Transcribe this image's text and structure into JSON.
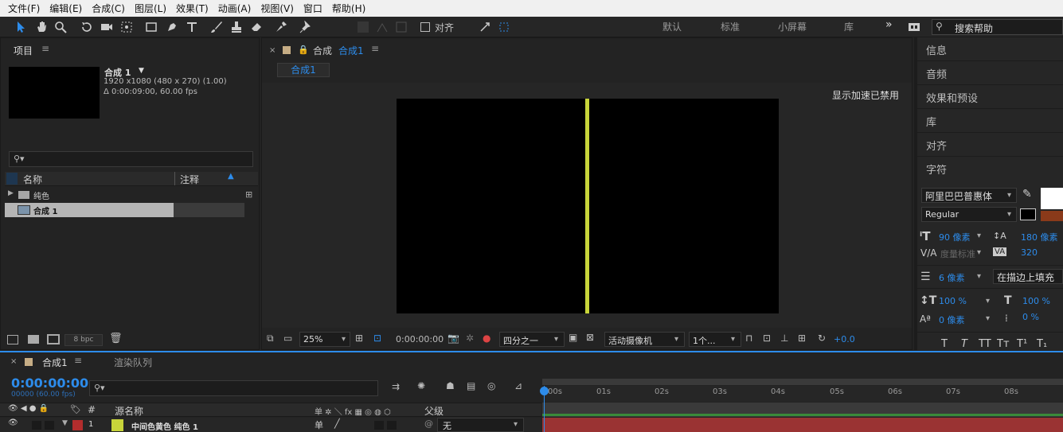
{
  "menu": [
    "文件(F)",
    "编辑(E)",
    "合成(C)",
    "图层(L)",
    "效果(T)",
    "动画(A)",
    "视图(V)",
    "窗口",
    "帮助(H)"
  ],
  "toolbar": {
    "align_label": "对齐",
    "workspaces": [
      "默认",
      "标准",
      "小屏幕",
      "库"
    ],
    "more": "»",
    "search_placeholder": "搜索帮助"
  },
  "project": {
    "title": "项目",
    "comp_name": "合成 1",
    "comp_arrow": "▼",
    "comp_info1": "1920 x1080  (480 x 270)  (1.00)",
    "comp_info2": "Δ 0:00:09:00, 60.00 fps",
    "search_icon": "⚲▾",
    "col_name": "名称",
    "col_comment": "注释",
    "items": [
      {
        "name": "纯色",
        "type": "folder"
      },
      {
        "name": "合成 1",
        "type": "comp"
      }
    ],
    "bpc": "8 bpc"
  },
  "comp_panel": {
    "tab_prefix": "合成",
    "tab_name": "合成1",
    "subtab": "合成1",
    "accel_notice": "显示加速已禁用",
    "zoom": "25%",
    "timecode": "0:00:00:00",
    "resolution": "四分之一",
    "camera": "活动摄像机",
    "views": "1个...",
    "exposure": "+0.0",
    "line_color": "#c8d43a"
  },
  "right_panel": {
    "items": [
      "信息",
      "音频",
      "效果和预设",
      "库",
      "对齐",
      "字符"
    ],
    "font_family": "阿里巴巴普惠体",
    "font_style": "Regular",
    "font_size": "90 像素",
    "leading": "180 像素",
    "kerning": "度量标准",
    "tracking": "320",
    "stroke_width": "6 像素",
    "stroke_mode": "在描边上填充",
    "vscale": "100 %",
    "hscale": "100 %",
    "baseline": "0 像素",
    "tsume": "0 %",
    "glyph_buttons": [
      "T",
      "T",
      "TT",
      "Tт",
      "T¹",
      "T₁"
    ]
  },
  "timeline": {
    "tab_name": "合成1",
    "render_tab": "渲染队列",
    "timecode": "0:00:00:00",
    "sub_timecode": "00000 (60.00 fps)",
    "search_icon": "⚲▾",
    "col_source": "源名称",
    "col_switches": "单 ✲ ＼ fx ▦ ◎ ◍ ⬡",
    "col_parent": "父级",
    "layer": {
      "index": "1",
      "name": "中间色黄色 纯色 1",
      "parent": "无",
      "label_color": "#b32d2d",
      "swatch_color": "#c8d43a"
    },
    "ticks": [
      "00s",
      "01s",
      "02s",
      "03s",
      "04s",
      "05s",
      "06s",
      "07s",
      "08s"
    ]
  }
}
